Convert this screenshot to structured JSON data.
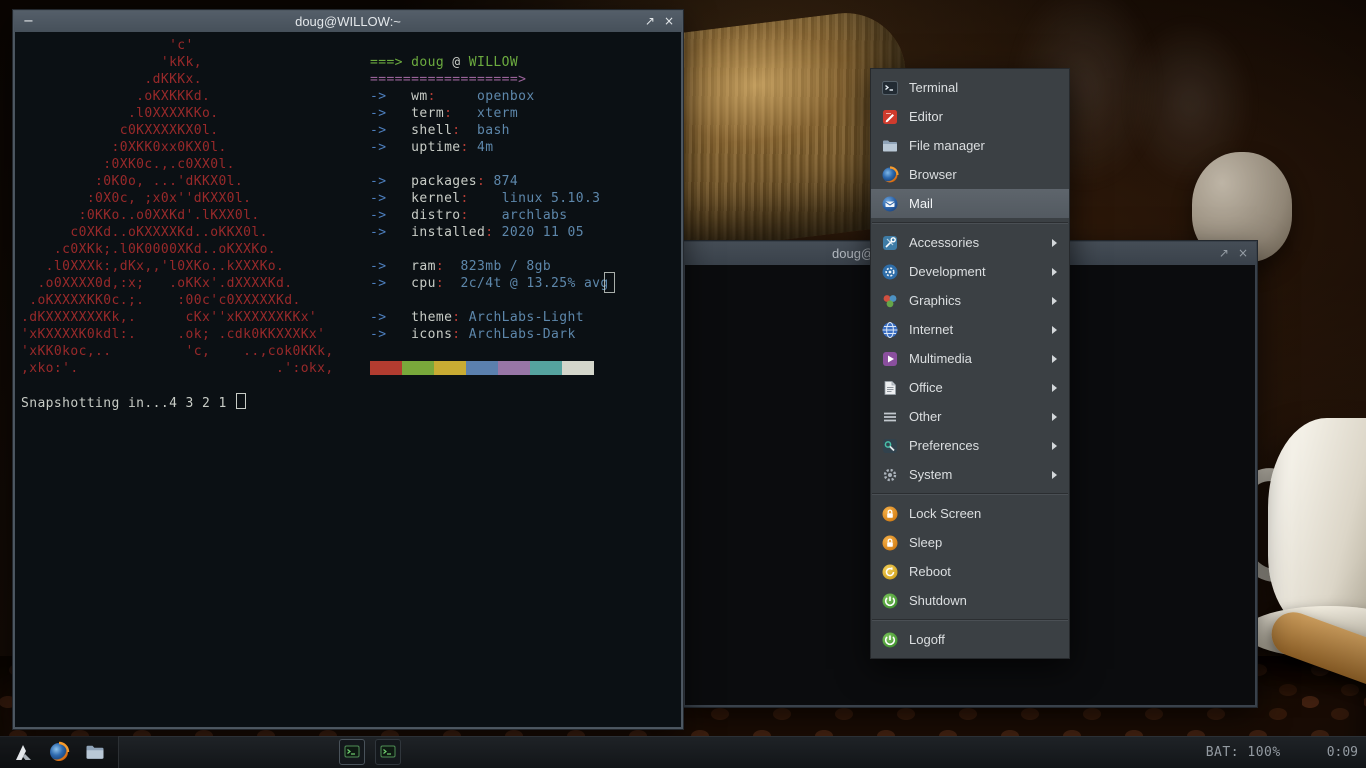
{
  "window1": {
    "title": "doug@WILLOW:~",
    "minimize_glyph": "−",
    "restore_glyph": "↗",
    "close_glyph": "×",
    "terminal": {
      "colors": {
        "logo": "#99292a",
        "green": "#6cab3f",
        "magenta": "#9a639a",
        "arrow": "#4d7fbe",
        "label": "#c8ccc6",
        "colon": "#b23c35",
        "value": "#5d87ab"
      },
      "logo_lines": [
        "                  'c'",
        "                 'kKk,",
        "               .dKKKx.",
        "              .oKXKKKd.",
        "             .l0XXXXKKo.",
        "            c0KXXXXKX0l.",
        "           :0XKK0xx0KX0l.",
        "          :0XK0c.,.c0XX0l.",
        "         :0K0o, ...'dKKX0l.",
        "        :0X0c, ;x0x''dKXX0l.",
        "       :0KKo..o0XXKd'.lKXX0l.",
        "      c0XKd..oKXXXXKd..oKKX0l.",
        "    .c0XKk;.l0K0000XKd..oKXXKo.",
        "   .l0XXXk:,dKx,,'l0XKo..kXXXKo.",
        "  .o0XXXX0d,:x;   .oKKx'.dXXXXKd.",
        " .oKXXXXKK0c.;.    :00c'c0XXXXXKd.",
        ".dKXXXXXXXKk,.      cKx''xKXXXXXKKx'",
        "'xKXXXXK0kdl:.     .ok; .cdk0KKXXXKx'",
        "'xKK0koc,..         'c,    ..,cok0KKk,",
        ",xko:'.                        .':okx,"
      ],
      "info_lines": [
        [
          [
            "green",
            "===> "
          ],
          [
            "green",
            "doug"
          ],
          [
            "plain",
            " @ "
          ],
          [
            "green",
            "WILLOW"
          ]
        ],
        [
          [
            "magenta",
            "==================>"
          ]
        ],
        [
          [
            "arrow",
            "->"
          ],
          [
            "plain",
            "   "
          ],
          [
            "label",
            "wm"
          ],
          [
            "colon",
            ":"
          ],
          [
            "plain",
            "     "
          ],
          [
            "value",
            "openbox"
          ]
        ],
        [
          [
            "arrow",
            "->"
          ],
          [
            "plain",
            "   "
          ],
          [
            "label",
            "term"
          ],
          [
            "colon",
            ":"
          ],
          [
            "plain",
            "   "
          ],
          [
            "value",
            "xterm"
          ]
        ],
        [
          [
            "arrow",
            "->"
          ],
          [
            "plain",
            "   "
          ],
          [
            "label",
            "shell"
          ],
          [
            "colon",
            ":"
          ],
          [
            "plain",
            "  "
          ],
          [
            "value",
            "bash"
          ]
        ],
        [
          [
            "arrow",
            "->"
          ],
          [
            "plain",
            "   "
          ],
          [
            "label",
            "uptime"
          ],
          [
            "colon",
            ":"
          ],
          [
            "plain",
            " "
          ],
          [
            "value",
            "4m"
          ]
        ],
        [],
        [
          [
            "arrow",
            "->"
          ],
          [
            "plain",
            "   "
          ],
          [
            "label",
            "packages"
          ],
          [
            "colon",
            ":"
          ],
          [
            "plain",
            " "
          ],
          [
            "value",
            "874"
          ]
        ],
        [
          [
            "arrow",
            "->"
          ],
          [
            "plain",
            "   "
          ],
          [
            "label",
            "kernel"
          ],
          [
            "colon",
            ":"
          ],
          [
            "plain",
            "    "
          ],
          [
            "value",
            "linux 5.10.3"
          ]
        ],
        [
          [
            "arrow",
            "->"
          ],
          [
            "plain",
            "   "
          ],
          [
            "label",
            "distro"
          ],
          [
            "colon",
            ":"
          ],
          [
            "plain",
            "    "
          ],
          [
            "value",
            "archlabs"
          ]
        ],
        [
          [
            "arrow",
            "->"
          ],
          [
            "plain",
            "   "
          ],
          [
            "label",
            "installed"
          ],
          [
            "colon",
            ":"
          ],
          [
            "plain",
            " "
          ],
          [
            "value",
            "2020 11 05"
          ]
        ],
        [],
        [
          [
            "arrow",
            "->"
          ],
          [
            "plain",
            "   "
          ],
          [
            "label",
            "ram"
          ],
          [
            "colon",
            ":"
          ],
          [
            "plain",
            "  "
          ],
          [
            "value",
            "823mb / 8gb"
          ]
        ],
        [
          [
            "arrow",
            "->"
          ],
          [
            "plain",
            "   "
          ],
          [
            "label",
            "cpu"
          ],
          [
            "colon",
            ":"
          ],
          [
            "plain",
            "  "
          ],
          [
            "value",
            "2c/4t @ 13.25% avg"
          ]
        ],
        [],
        [
          [
            "arrow",
            "->"
          ],
          [
            "plain",
            "   "
          ],
          [
            "label",
            "theme"
          ],
          [
            "colon",
            ":"
          ],
          [
            "plain",
            " "
          ],
          [
            "value",
            "ArchLabs-Light"
          ]
        ],
        [
          [
            "arrow",
            "->"
          ],
          [
            "plain",
            "   "
          ],
          [
            "label",
            "icons"
          ],
          [
            "colon",
            ":"
          ],
          [
            "plain",
            " "
          ],
          [
            "value",
            "ArchLabs-Dark"
          ]
        ]
      ],
      "palette": [
        "#b23c30",
        "#79a83b",
        "#c8ab33",
        "#5b80ae",
        "#9876a6",
        "#55a39f",
        "#d4d6cb"
      ],
      "prompt": "Snapshotting in...4 3 2 1 "
    }
  },
  "window2": {
    "title": "doug@",
    "restore_glyph": "↗",
    "close_glyph": "×"
  },
  "menu": {
    "highlight_color": "#585f66",
    "items": [
      {
        "label": "Terminal",
        "icon": "terminal"
      },
      {
        "label": "Editor",
        "icon": "editor"
      },
      {
        "label": "File manager",
        "icon": "file-manager"
      },
      {
        "label": "Browser",
        "icon": "browser"
      },
      {
        "label": "Mail",
        "icon": "mail",
        "selected": true
      },
      {
        "separator": true
      },
      {
        "label": "Accessories",
        "icon": "accessories",
        "submenu": true
      },
      {
        "label": "Development",
        "icon": "development",
        "submenu": true
      },
      {
        "label": "Graphics",
        "icon": "graphics",
        "submenu": true
      },
      {
        "label": "Internet",
        "icon": "internet",
        "submenu": true
      },
      {
        "label": "Multimedia",
        "icon": "multimedia",
        "submenu": true
      },
      {
        "label": "Office",
        "icon": "office",
        "submenu": true
      },
      {
        "label": "Other",
        "icon": "other",
        "submenu": true
      },
      {
        "label": "Preferences",
        "icon": "preferences",
        "submenu": true
      },
      {
        "label": "System",
        "icon": "system",
        "submenu": true
      },
      {
        "separator": true
      },
      {
        "label": "Lock Screen",
        "icon": "lock-screen"
      },
      {
        "label": "Sleep",
        "icon": "sleep"
      },
      {
        "label": "Reboot",
        "icon": "reboot"
      },
      {
        "label": "Shutdown",
        "icon": "shutdown"
      },
      {
        "separator": true
      },
      {
        "label": "Logoff",
        "icon": "logoff"
      }
    ]
  },
  "panel": {
    "launchers": [
      "archlabs",
      "firefox",
      "file-manager"
    ],
    "taskbar_buttons": [
      "terminal",
      "terminal"
    ],
    "battery_label": "BAT: 100%",
    "clock": "0:09"
  }
}
